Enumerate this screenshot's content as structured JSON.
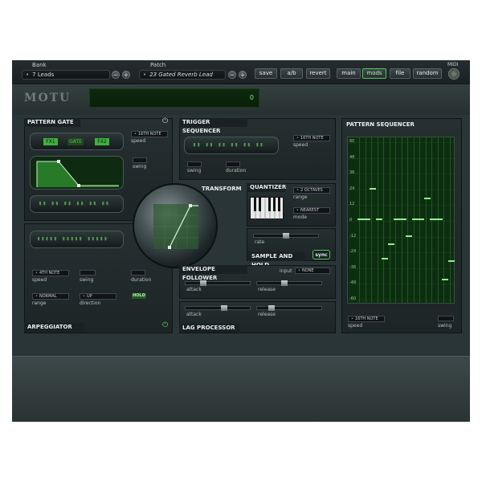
{
  "topbar": {
    "bank_label": "Bank",
    "bank_value": "7 Leads",
    "patch_label": "Patch",
    "patch_value": "23 Gated Reverb Lead",
    "buttons": [
      "save",
      "a/b",
      "revert",
      "main",
      "mods",
      "file",
      "random"
    ],
    "active_button": "mods",
    "midi_label": "MIDI"
  },
  "logo": "MOTU",
  "display_value": "0",
  "pattern_gate": {
    "title": "PATTERN GATE",
    "fx1": "FX1",
    "gate": "GATE",
    "fx2": "FX2",
    "speed_value": "16TH NOTE",
    "speed_label": "speed",
    "swing_label": "swing"
  },
  "trigger_sequencer": {
    "title": "TRIGGER SEQUENCER",
    "speed_value": "16TH NOTE",
    "speed_label": "speed",
    "swing_label": "swing",
    "duration_label": "duration"
  },
  "transform": {
    "title": "TRANSFORM"
  },
  "quantizer": {
    "title": "QUANTIZER",
    "range_value": "2 OCTAVES",
    "range_label": "range",
    "mode_value": "NEAREST",
    "mode_label": "mode"
  },
  "sample_hold": {
    "title": "SAMPLE AND HOLD",
    "rate_label": "rate",
    "sync_label": "sync"
  },
  "arpeggiator": {
    "title": "ARPEGGIATOR",
    "speed_value": "4TH NOTE",
    "speed_label": "speed",
    "swing_label": "swing",
    "duration_label": "duration",
    "range_value": "NORMAL",
    "range_label": "range",
    "direction_value": "UP",
    "direction_label": "direction",
    "hold_label": "HOLD"
  },
  "envelope_follower": {
    "title": "ENVELOPE FOLLOWER",
    "input_label": "input",
    "input_value": "NONE",
    "attack_label": "attack",
    "release_label": "release"
  },
  "lag_processor": {
    "title": "LAG PROCESSOR",
    "attack_label": "attack",
    "release_label": "release"
  },
  "pattern_sequencer": {
    "title": "PATTERN SEQUENCER",
    "scale": [
      "60",
      "48",
      "36",
      "24",
      "12",
      "0",
      "-12",
      "-24",
      "-36",
      "-48",
      "-60"
    ],
    "speed_value": "16TH NOTE",
    "speed_label": "speed",
    "swing_label": "swing"
  },
  "icons": {
    "power": "power-icon"
  },
  "colors": {
    "accent_green": "#58c45a",
    "lcd_text": "#7ef07e"
  }
}
